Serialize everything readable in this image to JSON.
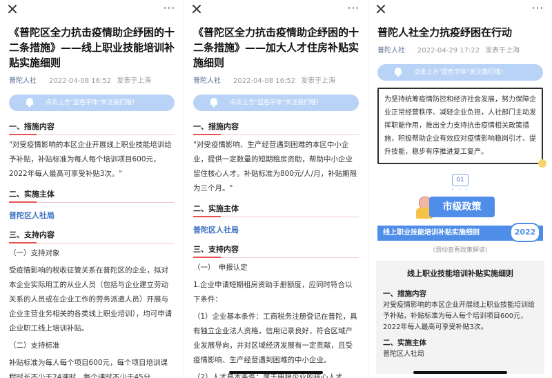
{
  "screens": [
    {
      "title": "《普陀区全力抗击疫情助企纾困的十二条措施》——线上职业技能培训补贴实施细则",
      "author": "普陀人社",
      "date": "2022-04-08 16:52",
      "location": "发表于上海",
      "banner": "点击上方\"蓝色字体\"关注我们哦！",
      "sec1": "一、措施内容",
      "p1": "\"对受疫情影响的本区企业开展线上职业技能培训给予补贴，补贴标准为每人每个培训项目600元，2022年每人最高可享受补贴3次。\"",
      "sec2": "二、实施主体",
      "blue": "普陀区人社局",
      "sec3": "三、支持内容",
      "sub1": "（一）支持对象",
      "p2": "受疫情影响的税收征管关系在普陀区的企业，拟对本企业实际用工的从业人员（包括与企业建立劳动关系的人员或在企业工作的劳务派遣人员）开展与企业主营业务相关的各类线上职业培训），均可申请企业职工线上培训补贴。",
      "sub2": "（二）支持标准",
      "p3": "补贴标准为每人每个项目600元，每个项目培训课程时长不少于24课时，每个课时不少于45分"
    },
    {
      "title": "《普陀区全力抗击疫情助企纾困的十二条措施》——加大人才住房补贴实施细则",
      "author": "普陀人社",
      "date": "2022-04-08 16:52",
      "location": "发表于上海",
      "banner": "点击上方\"蓝色字体\"关注我们哦！",
      "sec1": "一、措施内容",
      "p1": "\"对受疫情影响、生产经营遇到困难的本区中小企业，提供一定数量的短期租房资助，帮助中小企业留住核心人才。补贴标准为800元/人/月，补贴期限为三个月。\"",
      "sec2": "二、实施主体",
      "blue": "普陀区人社局",
      "sec3": "三、支持内容",
      "sub1": "（一）　申报认定",
      "p2": "1.企业申请短期租房资助手册额度，应同时符合以下条件：",
      "p3": "（1）企业基本条件：工商税务注册登记在普陀，具有独立企业法人资格，信用记录良好，符合区域产业发展导向，并对区域经济发展有一定贡献，且受疫情影响、生产经营遇到困难的中小企业。",
      "p4": "（2）人才基本条件：属于申报企业的核心人才"
    },
    {
      "title": "普陀人社全力抗疫纾困在行动",
      "author": "普陀人社",
      "date": "2022-04-29 17:22",
      "location": "发表于上海",
      "banner": "点击上方\"蓝色字体\"关注我们哦！",
      "intro": "为坚持统筹疫情防控和经济社会发展，努力保障企业正常经营秩序、减轻企业负担，人社部门主动发挥职能作用，推出全力支持抗击疫情相关政策措施，积极帮助企业有效应对疫情影响稳岗引才、提升技能，稳步有序推进复工复产。",
      "num": "01",
      "policy": "市级政策",
      "strip": "线上职业技能培训补贴实施细则",
      "year": "2022",
      "hint": "(滑动查看政策解读)",
      "box_title": "线上职业技能培训补贴实施细则",
      "box_sec1": "一、措施内容",
      "box_p1": "对受疫情影响的本区企业开展线上职业技能培训给予补贴，补贴标准为每人每个培训项目600元，2022年每人最高可享受补贴3次。",
      "box_sec2": "二、实施主体",
      "box_p2": "普陀区人社局"
    }
  ]
}
